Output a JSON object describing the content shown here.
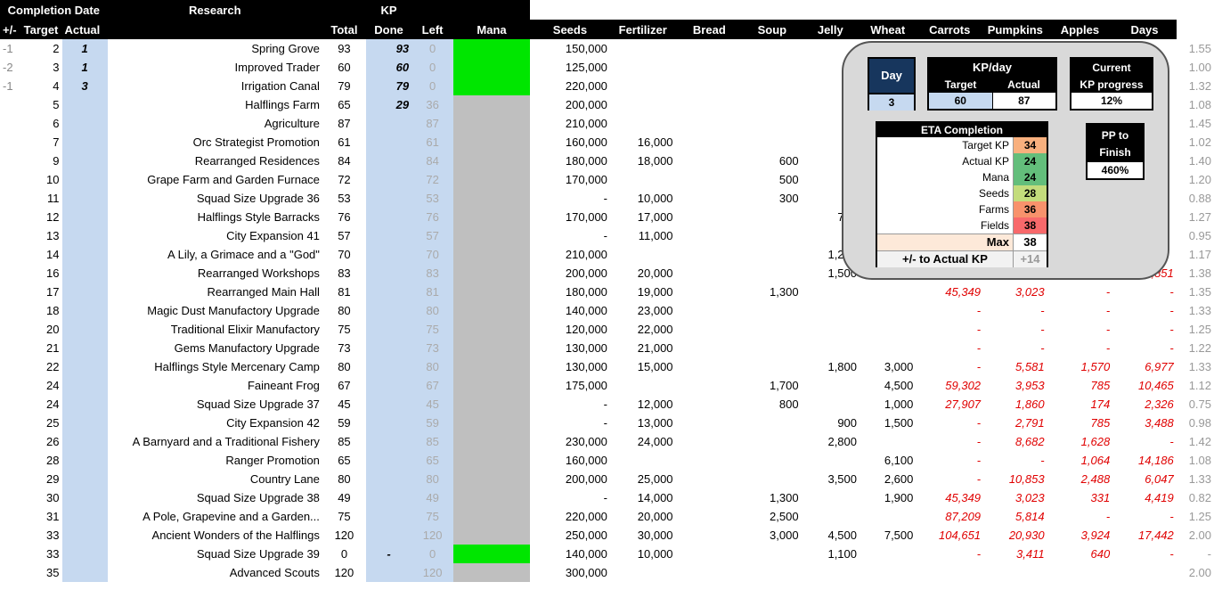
{
  "header": {
    "completion_date": "Completion Date",
    "plus_minus": "+/-",
    "target": "Target",
    "actual": "Actual",
    "research": "Research",
    "kp": "KP",
    "total": "Total",
    "done": "Done",
    "left": "Left",
    "resources": [
      "Mana",
      "Seeds",
      "Fertilizer",
      "Bread",
      "Soup",
      "Jelly",
      "Wheat",
      "Carrots",
      "Pumpkins",
      "Apples",
      "Days"
    ]
  },
  "rows": [
    {
      "pm": "-1",
      "tgt": "2",
      "act": "1",
      "name": "Spring Grove",
      "total": "93",
      "done": "93",
      "left": "0",
      "bar": "green",
      "mana": "150,000",
      "seeds": "",
      "fert": "",
      "bread": "",
      "soup": "",
      "jelly": "",
      "wheat": "",
      "carrots": "",
      "pumpkins": "",
      "apples": "",
      "days": "1.55"
    },
    {
      "pm": "-2",
      "tgt": "3",
      "act": "1",
      "name": "Improved Trader",
      "total": "60",
      "done": "60",
      "left": "0",
      "bar": "green",
      "mana": "125,000",
      "seeds": "",
      "fert": "",
      "bread": "",
      "soup": "",
      "jelly": "",
      "wheat": "",
      "carrots": "",
      "pumpkins": "",
      "apples": "",
      "days": "1.00"
    },
    {
      "pm": "-1",
      "tgt": "4",
      "act": "3",
      "name": "Irrigation Canal",
      "total": "79",
      "done": "79",
      "left": "0",
      "bar": "green",
      "mana": "220,000",
      "seeds": "",
      "fert": "",
      "bread": "",
      "soup": "",
      "jelly": "",
      "wheat": "",
      "carrots": "",
      "pumpkins": "",
      "apples": "",
      "days": "1.32"
    },
    {
      "pm": "",
      "tgt": "5",
      "act": "",
      "name": "Halflings Farm",
      "total": "65",
      "done": "29",
      "left": "36",
      "bar": "gray",
      "mana": "200,000",
      "seeds": "",
      "fert": "",
      "bread": "",
      "soup": "",
      "jelly": "",
      "wheat": "",
      "carrots": "",
      "pumpkins": "",
      "apples": "",
      "days": "1.08"
    },
    {
      "pm": "",
      "tgt": "6",
      "act": "",
      "name": "Agriculture",
      "total": "87",
      "done": "",
      "left": "87",
      "bar": "gray",
      "mana": "210,000",
      "seeds": "",
      "fert": "",
      "bread": "",
      "soup": "",
      "jelly": "",
      "wheat": "",
      "carrots": "",
      "pumpkins": "",
      "apples": "",
      "days": "1.45"
    },
    {
      "pm": "",
      "tgt": "7",
      "act": "",
      "name": "Orc Strategist Promotion",
      "total": "61",
      "done": "",
      "left": "61",
      "bar": "gray",
      "mana": "160,000",
      "seeds": "16,000",
      "fert": "",
      "bread": "",
      "soup": "",
      "jelly": "",
      "wheat": "",
      "carrots": "",
      "pumpkins": "",
      "apples": "",
      "days": "1.02"
    },
    {
      "pm": "",
      "tgt": "9",
      "act": "",
      "name": "Rearranged Residences",
      "total": "84",
      "done": "",
      "left": "84",
      "bar": "gray",
      "mana": "180,000",
      "seeds": "18,000",
      "fert": "",
      "bread": "600",
      "soup": "",
      "jelly": "",
      "wheat": "",
      "carrots": "",
      "pumpkins": "",
      "apples": "",
      "days": "1.40"
    },
    {
      "pm": "",
      "tgt": "10",
      "act": "",
      "name": "Grape Farm and Garden Furnace",
      "total": "72",
      "done": "",
      "left": "72",
      "bar": "gray",
      "mana": "170,000",
      "seeds": "",
      "fert": "",
      "bread": "500",
      "soup": "",
      "jelly": "",
      "wheat": "",
      "carrots": "",
      "pumpkins": "",
      "apples": "",
      "days": "1.20"
    },
    {
      "pm": "",
      "tgt": "11",
      "act": "",
      "name": "Squad Size Upgrade 36",
      "total": "53",
      "done": "",
      "left": "53",
      "bar": "gray",
      "mana": "-",
      "seeds": "10,000",
      "fert": "",
      "bread": "300",
      "soup": "",
      "jelly": "",
      "wheat": "",
      "carrots": "",
      "pumpkins": "",
      "apples": "",
      "days": "0.88"
    },
    {
      "pm": "",
      "tgt": "12",
      "act": "",
      "name": "Halflings Style Barracks",
      "total": "76",
      "done": "",
      "left": "76",
      "bar": "gray",
      "mana": "170,000",
      "seeds": "17,000",
      "fert": "",
      "bread": "",
      "soup": "700",
      "jelly": "",
      "wheat": "",
      "carrots": "",
      "pumpkins": "",
      "apples": "",
      "days": "1.27"
    },
    {
      "pm": "",
      "tgt": "13",
      "act": "",
      "name": "City Expansion 41",
      "total": "57",
      "done": "",
      "left": "57",
      "bar": "gray",
      "mana": "-",
      "seeds": "11,000",
      "fert": "",
      "bread": "",
      "soup": "",
      "jelly": "",
      "wheat": "",
      "carrots": "",
      "pumpkins": "",
      "apples": "",
      "days": "0.95"
    },
    {
      "pm": "",
      "tgt": "14",
      "act": "",
      "name": "A Lily, a Grimace and a \"God\"",
      "total": "70",
      "done": "",
      "left": "70",
      "bar": "gray",
      "mana": "210,000",
      "seeds": "",
      "fert": "",
      "bread": "",
      "soup": "1,200",
      "jelly": "",
      "wheat": "",
      "carrots": "",
      "pumpkins": "",
      "apples": "",
      "days": "1.17"
    },
    {
      "pm": "",
      "tgt": "16",
      "act": "",
      "name": "Rearranged Workshops",
      "total": "83",
      "done": "",
      "left": "83",
      "bar": "gray",
      "mana": "200,000",
      "seeds": "20,000",
      "fert": "",
      "bread": "",
      "soup": "1,500",
      "jelly": "",
      "wheat": "",
      "carrots": "",
      "pumpkins": "",
      "apples": ",851",
      "days": "1.38"
    },
    {
      "pm": "",
      "tgt": "17",
      "act": "",
      "name": "Rearranged Main Hall",
      "total": "81",
      "done": "",
      "left": "81",
      "bar": "gray",
      "mana": "180,000",
      "seeds": "19,000",
      "fert": "",
      "bread": "1,300",
      "soup": "",
      "jelly": "",
      "wheat": "45,349",
      "carrots": "3,023",
      "pumpkins": "-",
      "apples": "-",
      "days": "1.35"
    },
    {
      "pm": "",
      "tgt": "18",
      "act": "",
      "name": "Magic Dust Manufactory Upgrade",
      "total": "80",
      "done": "",
      "left": "80",
      "bar": "gray",
      "mana": "140,000",
      "seeds": "23,000",
      "fert": "",
      "bread": "",
      "soup": "",
      "jelly": "",
      "wheat": "-",
      "carrots": "-",
      "pumpkins": "-",
      "apples": "-",
      "days": "1.33"
    },
    {
      "pm": "",
      "tgt": "20",
      "act": "",
      "name": "Traditional Elixir Manufactory",
      "total": "75",
      "done": "",
      "left": "75",
      "bar": "gray",
      "mana": "120,000",
      "seeds": "22,000",
      "fert": "",
      "bread": "",
      "soup": "",
      "jelly": "",
      "wheat": "-",
      "carrots": "-",
      "pumpkins": "-",
      "apples": "-",
      "days": "1.25"
    },
    {
      "pm": "",
      "tgt": "21",
      "act": "",
      "name": "Gems Manufactory Upgrade",
      "total": "73",
      "done": "",
      "left": "73",
      "bar": "gray",
      "mana": "130,000",
      "seeds": "21,000",
      "fert": "",
      "bread": "",
      "soup": "",
      "jelly": "",
      "wheat": "-",
      "carrots": "-",
      "pumpkins": "-",
      "apples": "-",
      "days": "1.22"
    },
    {
      "pm": "",
      "tgt": "22",
      "act": "",
      "name": "Halflings Style Mercenary Camp",
      "total": "80",
      "done": "",
      "left": "80",
      "bar": "gray",
      "mana": "130,000",
      "seeds": "15,000",
      "fert": "",
      "bread": "",
      "soup": "1,800",
      "jelly": "3,000",
      "wheat": "-",
      "carrots": "5,581",
      "pumpkins": "1,570",
      "apples": "6,977",
      "days": "1.33"
    },
    {
      "pm": "",
      "tgt": "24",
      "act": "",
      "name": "Faineant Frog",
      "total": "67",
      "done": "",
      "left": "67",
      "bar": "gray",
      "mana": "175,000",
      "seeds": "",
      "fert": "",
      "bread": "1,700",
      "soup": "",
      "jelly": "4,500",
      "wheat": "59,302",
      "carrots": "3,953",
      "pumpkins": "785",
      "apples": "10,465",
      "days": "1.12"
    },
    {
      "pm": "",
      "tgt": "24",
      "act": "",
      "name": "Squad Size Upgrade 37",
      "total": "45",
      "done": "",
      "left": "45",
      "bar": "gray",
      "mana": "-",
      "seeds": "12,000",
      "fert": "",
      "bread": "800",
      "soup": "",
      "jelly": "1,000",
      "wheat": "27,907",
      "carrots": "1,860",
      "pumpkins": "174",
      "apples": "2,326",
      "days": "0.75"
    },
    {
      "pm": "",
      "tgt": "25",
      "act": "",
      "name": "City Expansion 42",
      "total": "59",
      "done": "",
      "left": "59",
      "bar": "gray",
      "mana": "-",
      "seeds": "13,000",
      "fert": "",
      "bread": "",
      "soup": "900",
      "jelly": "1,500",
      "wheat": "-",
      "carrots": "2,791",
      "pumpkins": "785",
      "apples": "3,488",
      "days": "0.98"
    },
    {
      "pm": "",
      "tgt": "26",
      "act": "",
      "name": "A Barnyard and a Traditional Fishery",
      "total": "85",
      "done": "",
      "left": "85",
      "bar": "gray",
      "mana": "230,000",
      "seeds": "24,000",
      "fert": "",
      "bread": "",
      "soup": "2,800",
      "jelly": "",
      "wheat": "-",
      "carrots": "8,682",
      "pumpkins": "1,628",
      "apples": "-",
      "days": "1.42"
    },
    {
      "pm": "",
      "tgt": "28",
      "act": "",
      "name": "Ranger Promotion",
      "total": "65",
      "done": "",
      "left": "65",
      "bar": "gray",
      "mana": "160,000",
      "seeds": "",
      "fert": "",
      "bread": "",
      "soup": "",
      "jelly": "6,100",
      "wheat": "-",
      "carrots": "-",
      "pumpkins": "1,064",
      "apples": "14,186",
      "days": "1.08"
    },
    {
      "pm": "",
      "tgt": "29",
      "act": "",
      "name": "Country Lane",
      "total": "80",
      "done": "",
      "left": "80",
      "bar": "gray",
      "mana": "200,000",
      "seeds": "25,000",
      "fert": "",
      "bread": "",
      "soup": "3,500",
      "jelly": "2,600",
      "wheat": "-",
      "carrots": "10,853",
      "pumpkins": "2,488",
      "apples": "6,047",
      "days": "1.33"
    },
    {
      "pm": "",
      "tgt": "30",
      "act": "",
      "name": "Squad Size Upgrade 38",
      "total": "49",
      "done": "",
      "left": "49",
      "bar": "gray",
      "mana": "-",
      "seeds": "14,000",
      "fert": "",
      "bread": "1,300",
      "soup": "",
      "jelly": "1,900",
      "wheat": "45,349",
      "carrots": "3,023",
      "pumpkins": "331",
      "apples": "4,419",
      "days": "0.82"
    },
    {
      "pm": "",
      "tgt": "31",
      "act": "",
      "name": "A Pole, Grapevine and a Garden...",
      "total": "75",
      "done": "",
      "left": "75",
      "bar": "gray",
      "mana": "220,000",
      "seeds": "20,000",
      "fert": "",
      "bread": "2,500",
      "soup": "",
      "jelly": "",
      "wheat": "87,209",
      "carrots": "5,814",
      "pumpkins": "-",
      "apples": "-",
      "days": "1.25"
    },
    {
      "pm": "",
      "tgt": "33",
      "act": "",
      "name": "Ancient Wonders of the Halflings",
      "total": "120",
      "done": "",
      "left": "120",
      "bar": "gray",
      "mana": "250,000",
      "seeds": "30,000",
      "fert": "",
      "bread": "3,000",
      "soup": "4,500",
      "jelly": "7,500",
      "wheat": "104,651",
      "carrots": "20,930",
      "pumpkins": "3,924",
      "apples": "17,442",
      "days": "2.00"
    },
    {
      "pm": "",
      "tgt": "33",
      "act": "",
      "name": "Squad Size Upgrade 39",
      "total": "0",
      "done": "-",
      "left": "0",
      "bar": "green",
      "mana": "140,000",
      "seeds": "10,000",
      "fert": "",
      "bread": "",
      "soup": "1,100",
      "jelly": "",
      "wheat": "-",
      "carrots": "3,411",
      "pumpkins": "640",
      "apples": "-",
      "days": "-"
    },
    {
      "pm": "",
      "tgt": "35",
      "act": "",
      "name": "Advanced Scouts",
      "total": "120",
      "done": "",
      "left": "120",
      "bar": "gray",
      "mana": "300,000",
      "seeds": "",
      "fert": "",
      "bread": "",
      "soup": "",
      "jelly": "",
      "wheat": "",
      "carrots": "",
      "pumpkins": "",
      "apples": "",
      "days": "2.00"
    }
  ],
  "panel": {
    "day_label": "Day",
    "day_value": "3",
    "kpday_label": "KP/day",
    "kpday_target_label": "Target",
    "kpday_actual_label": "Actual",
    "kpday_target": "60",
    "kpday_actual": "87",
    "current_label_1": "Current",
    "current_label_2": "KP progress",
    "current_value": "12%",
    "eta_title": "ETA Completion",
    "eta_rows": [
      {
        "label": "Target KP",
        "value": "34",
        "color": "#f8b07e"
      },
      {
        "label": "Actual KP",
        "value": "24",
        "color": "#63be7b"
      },
      {
        "label": "Mana",
        "value": "24",
        "color": "#63be7b"
      },
      {
        "label": "Seeds",
        "value": "28",
        "color": "#c3dc7c"
      },
      {
        "label": "Farms",
        "value": "36",
        "color": "#f8926c"
      },
      {
        "label": "Fields",
        "value": "38",
        "color": "#f8696b"
      }
    ],
    "max_label": "Max",
    "max_value": "38",
    "pm_actual_label": "+/- to Actual KP",
    "pm_actual_value": "+14",
    "pp_label_1": "PP to",
    "pp_label_2": "Finish",
    "pp_value": "460%"
  },
  "colors": {
    "green": "#00e600",
    "gray": "#bfbfbf",
    "blue": "#c6d9f0",
    "red": "#e00000",
    "navy": "#17365d"
  }
}
